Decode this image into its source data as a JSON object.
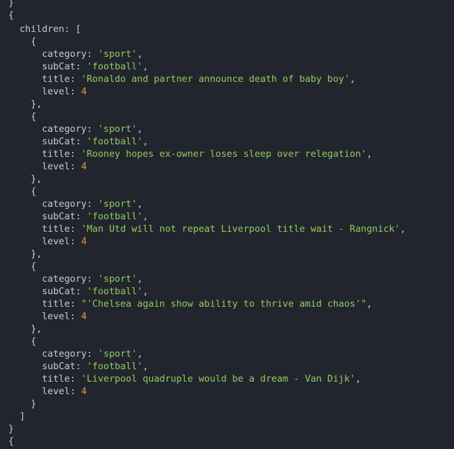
{
  "children_key": "children",
  "items": [
    {
      "category_key": "category",
      "category": "'sport'",
      "subCat_key": "subCat",
      "subCat": "'football'",
      "title_key": "title",
      "title": "'Ronaldo and partner announce death of baby boy'",
      "level_key": "level",
      "level": "4"
    },
    {
      "category_key": "category",
      "category": "'sport'",
      "subCat_key": "subCat",
      "subCat": "'football'",
      "title_key": "title",
      "title": "'Rooney hopes ex-owner loses sleep over relegation'",
      "level_key": "level",
      "level": "4"
    },
    {
      "category_key": "category",
      "category": "'sport'",
      "subCat_key": "subCat",
      "subCat": "'football'",
      "title_key": "title",
      "title": "'Man Utd will not repeat Liverpool title wait - Rangnick'",
      "level_key": "level",
      "level": "4"
    },
    {
      "category_key": "category",
      "category": "'sport'",
      "subCat_key": "subCat",
      "subCat": "'football'",
      "title_key": "title",
      "title": "\"'Chelsea again show ability to thrive amid chaos'\"",
      "level_key": "level",
      "level": "4"
    },
    {
      "category_key": "category",
      "category": "'sport'",
      "subCat_key": "subCat",
      "subCat": "'football'",
      "title_key": "title",
      "title": "'Liverpool quadruple would be a dream - Van Dijk'",
      "level_key": "level",
      "level": "4"
    }
  ]
}
